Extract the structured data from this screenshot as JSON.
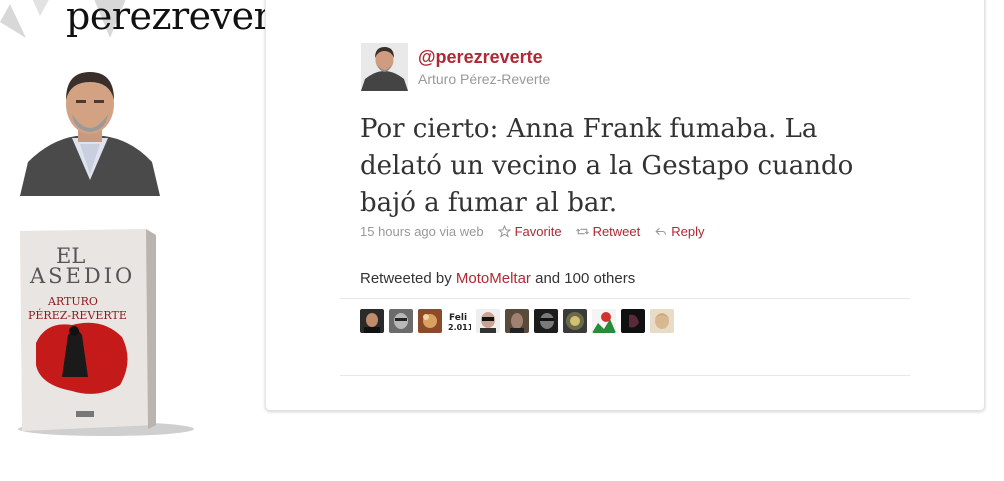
{
  "site": {
    "title": "perezrevert"
  },
  "book": {
    "title_line1": "EL",
    "title_line2": "ASEDIO",
    "author_line1": "ARTURO",
    "author_line2": "PÉREZ-REVERTE"
  },
  "tweet": {
    "handle": "@perezreverte",
    "name": "Arturo Pérez-Reverte",
    "text": "Por cierto: Anna Frank fumaba. La delató un vecino a la Gestapo cuando bajó a fumar al bar.",
    "timestamp": "15 hours ago via web",
    "actions": {
      "favorite": "Favorite",
      "retweet": "Retweet",
      "reply": "Reply"
    }
  },
  "retweets": {
    "prefix": "Retweeted by",
    "user": "MotoMeltar",
    "suffix": "and 100 others"
  },
  "retweeter_avatars": [
    {
      "name": "avatar-1"
    },
    {
      "name": "avatar-2"
    },
    {
      "name": "avatar-3"
    },
    {
      "name": "avatar-4",
      "label": "Feli 2.011"
    },
    {
      "name": "avatar-5"
    },
    {
      "name": "avatar-6"
    },
    {
      "name": "avatar-7"
    },
    {
      "name": "avatar-8"
    },
    {
      "name": "avatar-9"
    },
    {
      "name": "avatar-10"
    },
    {
      "name": "avatar-11"
    }
  ],
  "colors": {
    "accent": "#b02833",
    "muted": "#999999",
    "text": "#333333"
  }
}
